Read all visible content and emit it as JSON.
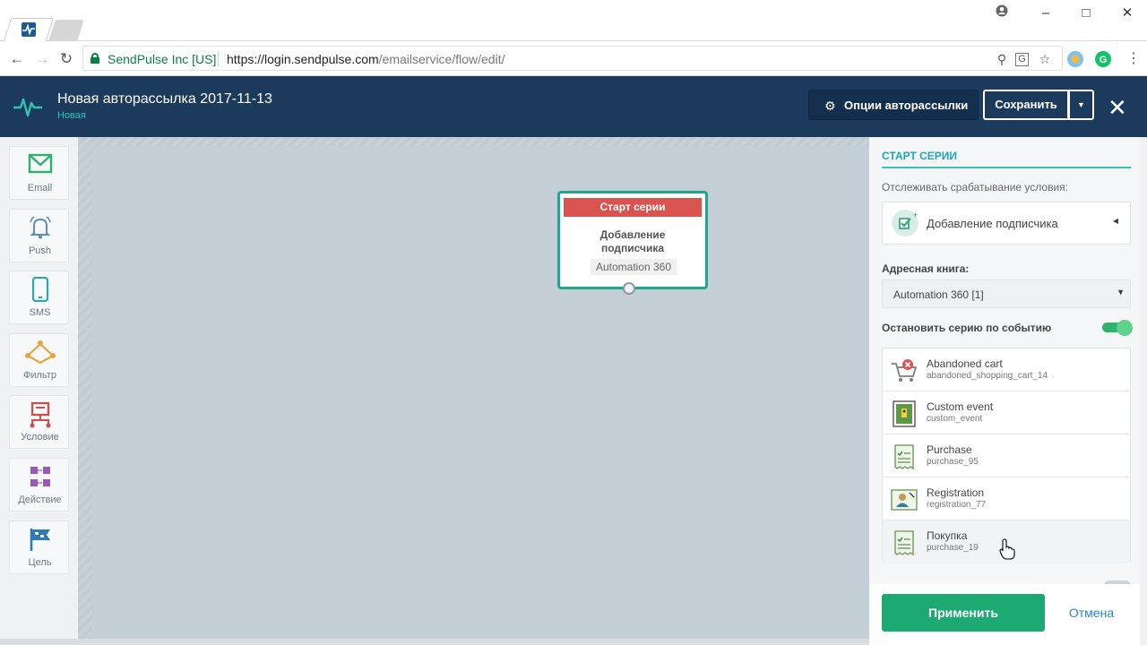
{
  "browser": {
    "secure_label": "SendPulse Inc [US]",
    "url_host": "https://login.sendpulse.com",
    "url_path": "/emailservice/flow/edit/"
  },
  "header": {
    "title": "Новая авторассылка 2017-11-13",
    "status": "Новая",
    "options_label": "Опции авторассылки",
    "save_label": "Сохранить"
  },
  "tools": [
    {
      "label": "Email",
      "icon": "email-icon",
      "color": "#2db36b"
    },
    {
      "label": "Push",
      "icon": "bell-icon",
      "color": "#5b8fb9"
    },
    {
      "label": "SMS",
      "icon": "phone-icon",
      "color": "#27a9b0"
    },
    {
      "label": "Фильтр",
      "icon": "filter-icon",
      "color": "#e6a63a"
    },
    {
      "label": "Условие",
      "icon": "condition-icon",
      "color": "#d14b4b"
    },
    {
      "label": "Действие",
      "icon": "action-icon",
      "color": "#9b59b6"
    },
    {
      "label": "Цель",
      "icon": "flag-icon",
      "color": "#2f79b6"
    }
  ],
  "node": {
    "header": "Старт серии",
    "title_line1": "Добавление",
    "title_line2": "подписчика",
    "tag": "Automation 360"
  },
  "panel": {
    "title": "СТАРТ СЕРИИ",
    "track_label": "Отслеживать срабатывание условия:",
    "trigger": "Добавление подписчика",
    "book_label": "Адресная книга:",
    "book_value": "Automation 360 [1]",
    "stop_label": "Остановить серию по событию",
    "stop_enabled": true,
    "events": [
      {
        "name": "Abandoned cart",
        "code": "abandoned_shopping_cart_14",
        "icon": "cart-icon"
      },
      {
        "name": "Custom event",
        "code": "custom_event",
        "icon": "custom-event-icon"
      },
      {
        "name": "Purchase",
        "code": "purchase_95",
        "icon": "receipt-icon"
      },
      {
        "name": "Registration",
        "code": "registration_77",
        "icon": "registration-icon"
      },
      {
        "name": "Покупка",
        "code": "purchase_19",
        "icon": "receipt-icon"
      }
    ],
    "apply_label": "Применить",
    "cancel_label": "Отмена"
  },
  "colors": {
    "header_bg": "#1b3a5c",
    "accent_teal": "#1fa6b9",
    "node_border": "#20a68a",
    "node_head": "#d9534f",
    "apply_green": "#1daa72",
    "cancel_blue": "#2b84c7"
  }
}
